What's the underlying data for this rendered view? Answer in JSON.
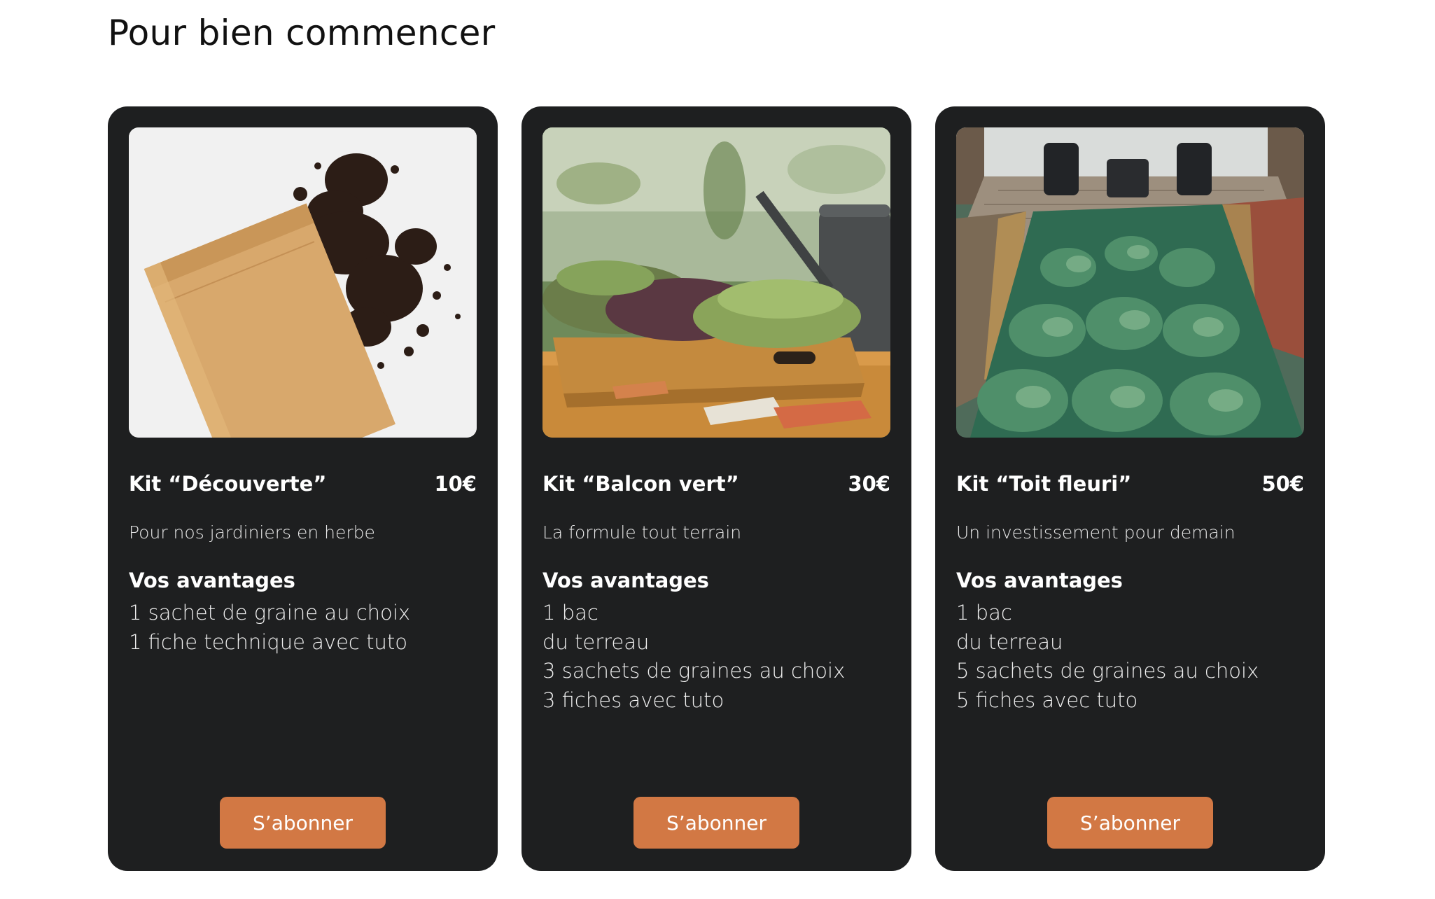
{
  "section": {
    "title": "Pour bien commencer"
  },
  "colors": {
    "card_background": "#1e1f20",
    "button": "#d27844",
    "page_background": "#ffffff"
  },
  "cards": [
    {
      "image_icon": "paper-bag-soil-image",
      "name": "Kit “Découverte”",
      "price": "10€",
      "tagline": "Pour nos jardiniers en herbe",
      "benefits_title": "Vos avantages",
      "benefits": [
        "1 sachet de graine au choix",
        "1 fiche technique avec tuto"
      ],
      "button_label": "S’abonner"
    },
    {
      "image_icon": "microgreens-tray-image",
      "name": "Kit “Balcon vert”",
      "price": "30€",
      "tagline": "La formule tout terrain",
      "benefits_title": "Vos avantages",
      "benefits": [
        "1 bac",
        "du terreau",
        "3 sachets de graines au choix",
        "3 fiches avec tuto"
      ],
      "button_label": "S’abonner"
    },
    {
      "image_icon": "rooftop-garden-image",
      "name": "Kit “Toit fleuri”",
      "price": "50€",
      "tagline": "Un investissement pour demain",
      "benefits_title": "Vos avantages",
      "benefits": [
        "1 bac",
        "du terreau",
        "5 sachets de graines au choix",
        "5 fiches avec tuto"
      ],
      "button_label": "S’abonner"
    }
  ]
}
